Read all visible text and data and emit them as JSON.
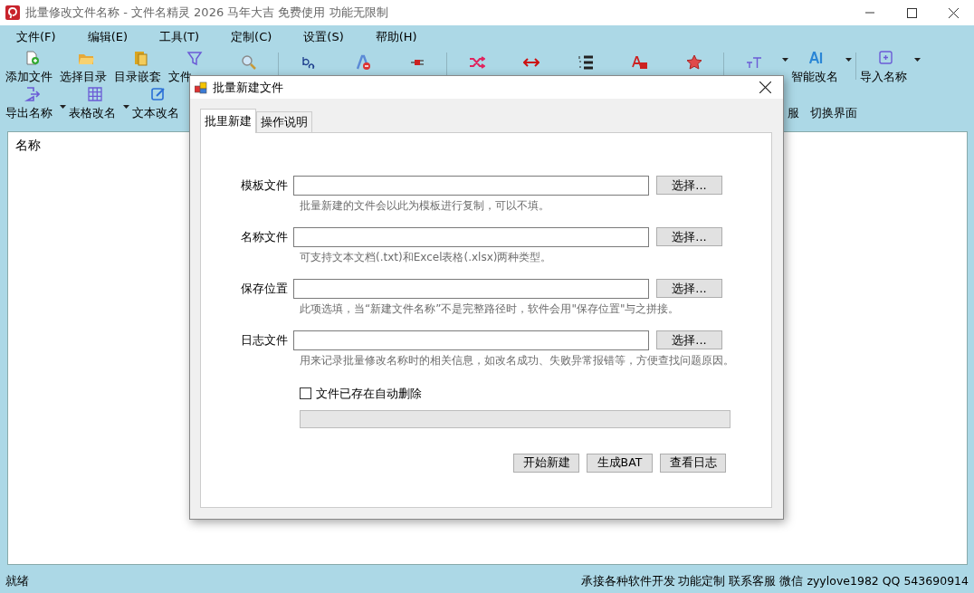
{
  "window": {
    "title": "批量修改文件名称 - 文件名精灵 2026 马年大吉 免费使用 功能无限制"
  },
  "menu": [
    "文件(F)",
    "编辑(E)",
    "工具(T)",
    "定制(C)",
    "设置(S)",
    "帮助(H)"
  ],
  "toolbar_rows": [
    [
      {
        "label": "添加文件",
        "dropdown": false
      },
      {
        "label": "选择目录",
        "dropdown": false
      },
      {
        "label": "目录嵌套",
        "dropdown": false
      },
      {
        "label": "文件",
        "dropdown": false
      },
      {
        "dropdown": false
      },
      {
        "kind": "separator"
      },
      {
        "dropdown": false
      },
      {
        "dropdown": false
      },
      {
        "dropdown": false
      },
      {
        "kind": "separator"
      },
      {
        "dropdown": false
      },
      {
        "dropdown": false
      },
      {
        "dropdown": false
      },
      {
        "dropdown": false
      },
      {
        "dropdown": false
      },
      {
        "kind": "separator"
      },
      {
        "dropdown": true
      },
      {
        "label": "智能改名",
        "dropdown": true
      },
      {
        "kind": "separator"
      },
      {
        "label": "导入名称",
        "dropdown": true
      }
    ],
    [
      {
        "label": "导出名称",
        "dropdown": true
      },
      {
        "label": "表格改名",
        "dropdown": true
      },
      {
        "label": "文本改名",
        "dropdown": false
      },
      {
        "kind": "spacer"
      },
      {
        "label": "服",
        "dropdown": false
      },
      {
        "label": "切换界面",
        "dropdown": false
      }
    ]
  ],
  "file_list": {
    "header": "名称"
  },
  "dialog": {
    "title": "批量新建文件",
    "tabs": [
      {
        "label": "批里新建",
        "selected": true
      },
      {
        "label": "操作说明",
        "selected": false
      }
    ],
    "fields": [
      {
        "label": "模板文件",
        "button": "选择...",
        "hint": "批量新建的文件会以此为模板进行复制，可以不填。"
      },
      {
        "label": "名称文件",
        "button": "选择...",
        "hint": "可支持文本文档(.txt)和Excel表格(.xlsx)两种类型。"
      },
      {
        "label": "保存位置",
        "button": "选择...",
        "hint": "此项选填，当“新建文件名称”不是完整路径时，软件会用\"保存位置\"与之拼接。"
      },
      {
        "label": "日志文件",
        "button": "选择...",
        "hint": "用来记录批量修改名称时的相关信息，如改名成功、失败异常报错等，方便查找问题原因。"
      }
    ],
    "checkbox": {
      "label": "文件已存在自动删除",
      "checked": false
    },
    "progress": {
      "level": 0
    },
    "buttons": [
      "开始新建",
      "生成BAT",
      "查看日志"
    ]
  },
  "status_bar": {
    "left": "就绪",
    "right": "承接各种软件开发 功能定制 联系客服 微信 zyylove1982 QQ 543690914"
  }
}
